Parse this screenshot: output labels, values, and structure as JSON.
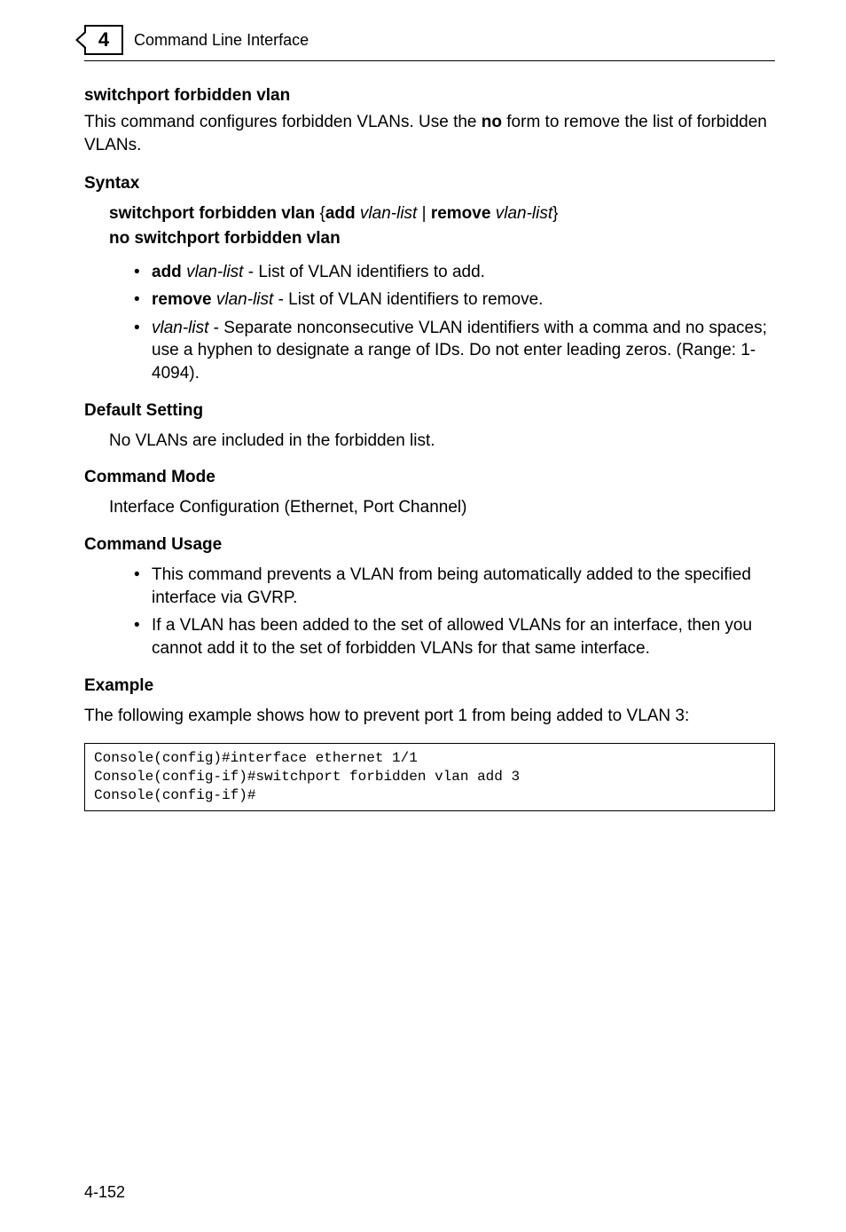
{
  "header": {
    "chapter_number": "4",
    "page_header": "Command Line Interface"
  },
  "command": {
    "title": "switchport forbidden vlan",
    "description_pre": "This command configures forbidden VLANs. Use the ",
    "description_bold": "no",
    "description_post": " form to remove the list of forbidden VLANs."
  },
  "syntax": {
    "heading": "Syntax",
    "line1": {
      "p1": "switchport forbidden vlan",
      "p2": " {",
      "p3": "add",
      "p4": " ",
      "p5": "vlan-list",
      "p6": " | ",
      "p7": "remove",
      "p8": " ",
      "p9": "vlan-list",
      "p10": "}"
    },
    "line2": "no switchport forbidden vlan",
    "bullets": {
      "b1": {
        "bold": "add",
        "space": " ",
        "ital": "vlan-list",
        "rest": " - List of VLAN identifiers to add."
      },
      "b2": {
        "bold": "remove",
        "space": " ",
        "ital": "vlan-list",
        "rest": " - List of VLAN identifiers to remove."
      },
      "b3": {
        "ital": "vlan-list",
        "rest": " - Separate nonconsecutive VLAN identifiers with a comma and no spaces; use a hyphen to designate a range of IDs. Do not enter leading zeros. (Range: 1-4094)."
      }
    }
  },
  "default_setting": {
    "heading": "Default Setting",
    "text": "No VLANs are included in the forbidden list."
  },
  "command_mode": {
    "heading": "Command Mode",
    "text": "Interface Configuration (Ethernet, Port Channel)"
  },
  "command_usage": {
    "heading": "Command Usage",
    "bullets": {
      "cu1": "This command prevents a VLAN from being automatically added to the specified interface via GVRP.",
      "cu2": "If a VLAN has been added to the set of allowed VLANs for an interface, then you cannot add it to the set of forbidden VLANs for that same interface."
    }
  },
  "example": {
    "heading": "Example",
    "intro": "The following example shows how to prevent port 1 from being added to VLAN 3:",
    "console": "Console(config)#interface ethernet 1/1\nConsole(config-if)#switchport forbidden vlan add 3\nConsole(config-if)#"
  },
  "footer": {
    "page_num": "4-152"
  }
}
